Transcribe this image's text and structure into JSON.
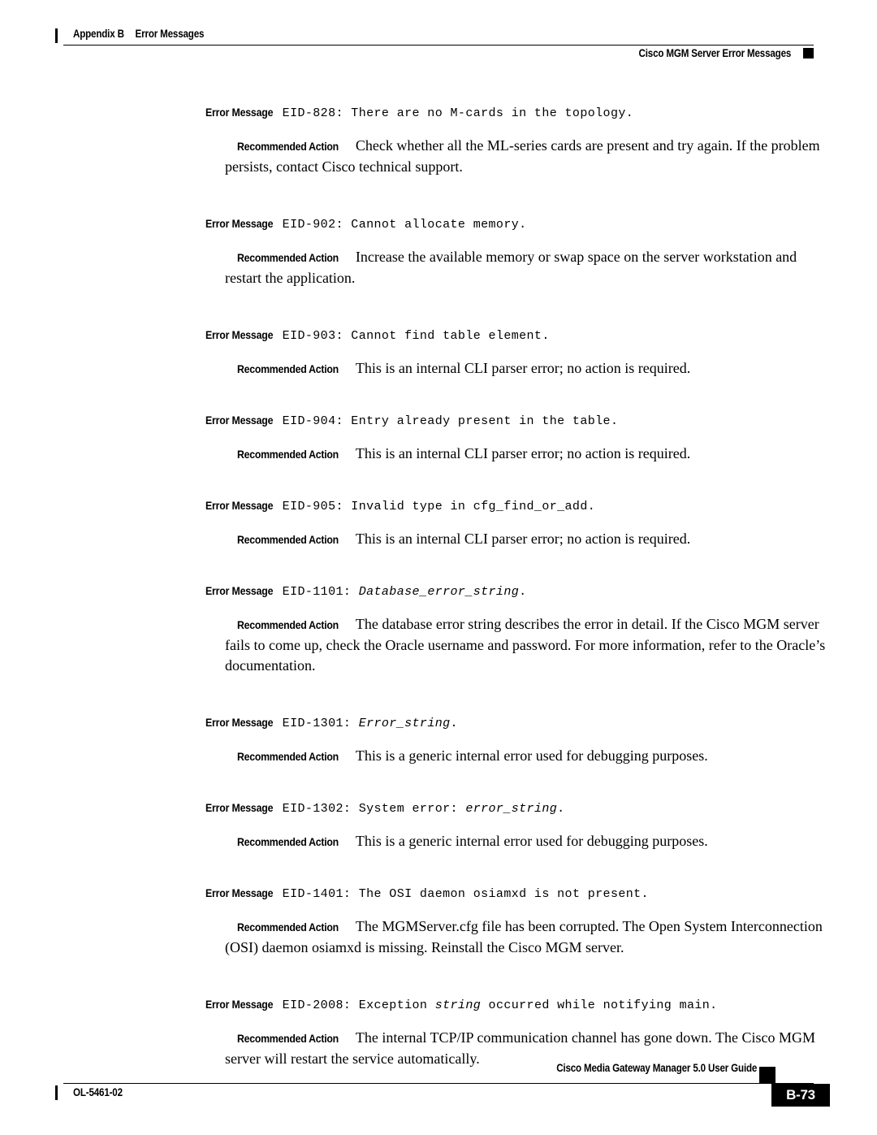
{
  "header": {
    "tick_icon": "vertical-bar-icon",
    "appendix": "Appendix B",
    "chapter_title": "Error Messages",
    "section_title": "Cisco MGM Server Error Messages",
    "square_icon": "black-square-marker-icon"
  },
  "footer": {
    "guide_title": "Cisco Media Gateway Manager 5.0 User Guide",
    "doc_number": "OL-5461-02",
    "page_number": "B-73",
    "square_icon": "black-square-marker-icon",
    "tick_icon": "vertical-bar-icon"
  },
  "labels": {
    "error_message": "Error Message",
    "recommended_action": "Recommended Action"
  },
  "blocks": [
    {
      "id": "eid-828",
      "code": "EID-828:",
      "message_roman": " There are no M-cards in the topology.",
      "message_italic": "",
      "message_roman2": "",
      "action": "Check whether all the ML-series cards are present and try again. If the problem persists, contact Cisco technical support."
    },
    {
      "id": "eid-902",
      "code": "EID-902:",
      "message_roman": " Cannot allocate memory.",
      "message_italic": "",
      "message_roman2": "",
      "action": "Increase the available memory or swap space on the server workstation and restart the application."
    },
    {
      "id": "eid-903",
      "code": "EID-903:",
      "message_roman": " Cannot find table element.",
      "message_italic": "",
      "message_roman2": "",
      "action": "This is an internal CLI parser error; no action is required."
    },
    {
      "id": "eid-904",
      "code": "EID-904:",
      "message_roman": " Entry already present in the table.",
      "message_italic": "",
      "message_roman2": "",
      "action": "This is an internal CLI parser error; no action is required."
    },
    {
      "id": "eid-905",
      "code": "EID-905:",
      "message_roman": " Invalid type in cfg_find_or_add.",
      "message_italic": "",
      "message_roman2": "",
      "action": "This is an internal CLI parser error; no action is required."
    },
    {
      "id": "eid-1101",
      "code": "EID-1101:",
      "message_roman": " ",
      "message_italic": "Database_error_string",
      "message_roman2": ".",
      "action": "The database error string describes the error in detail. If the Cisco MGM server fails to come up, check the Oracle username and password. For more information, refer to the Oracle’s documentation."
    },
    {
      "id": "eid-1301",
      "code": "EID-1301:",
      "message_roman": " ",
      "message_italic": "Error_string",
      "message_roman2": ".",
      "action": "This is a generic internal error used for debugging purposes."
    },
    {
      "id": "eid-1302",
      "code": "EID-1302:",
      "message_roman": " System error: ",
      "message_italic": "error_string",
      "message_roman2": ".",
      "action": "This is a generic internal error used for debugging purposes."
    },
    {
      "id": "eid-1401",
      "code": "EID-1401:",
      "message_roman": " The OSI daemon osiamxd is not present.",
      "message_italic": "",
      "message_roman2": "",
      "action": "The MGMServer.cfg file has been corrupted. The Open System Interconnection (OSI) daemon osiamxd is missing. Reinstall the Cisco MGM server."
    },
    {
      "id": "eid-2008",
      "code": "EID-2008:",
      "message_roman": " Exception ",
      "message_italic": "string",
      "message_roman2": " occurred while notifying main.",
      "action": "The internal TCP/IP communication channel has gone down. The Cisco MGM server will restart the service automatically."
    }
  ]
}
